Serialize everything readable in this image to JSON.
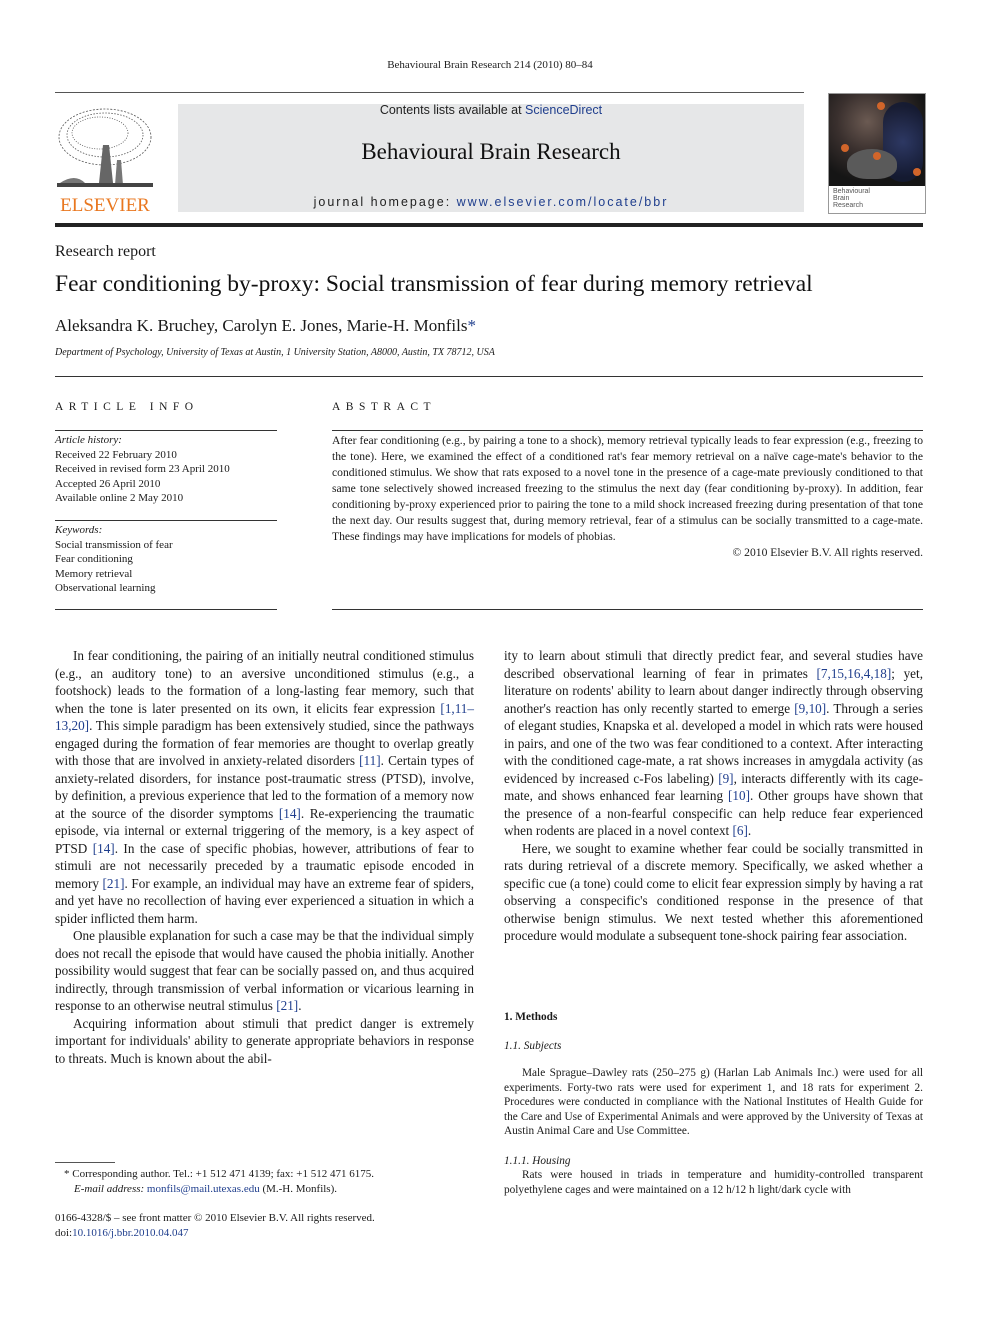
{
  "running_head": "Behavioural Brain Research 214 (2010) 80–84",
  "masthead": {
    "publisher_logo_text": "ELSEVIER",
    "contents_prefix": "Contents lists available at ",
    "contents_link": "ScienceDirect",
    "journal_title": "Behavioural Brain Research",
    "homepage_prefix": "journal homepage: ",
    "homepage_link": "www.elsevier.com/locate/bbr",
    "cover_text_lines": [
      "Behavioural",
      "Brain",
      "Research"
    ]
  },
  "article": {
    "type": "Research report",
    "title": "Fear conditioning by-proxy: Social transmission of fear during memory retrieval",
    "authors": "Aleksandra K. Bruchey, Carolyn E. Jones, Marie-H. Monfils",
    "corresponding_marker": "*",
    "affiliation": "Department of Psychology, University of Texas at Austin, 1 University Station, A8000, Austin, TX 78712, USA"
  },
  "article_info": {
    "heading": "ARTICLE INFO",
    "history_label": "Article history:",
    "history": [
      "Received 22 February 2010",
      "Received in revised form 23 April 2010",
      "Accepted 26 April 2010",
      "Available online 2 May 2010"
    ],
    "keywords_label": "Keywords:",
    "keywords": [
      "Social transmission of fear",
      "Fear conditioning",
      "Memory retrieval",
      "Observational learning"
    ]
  },
  "abstract": {
    "heading": "ABSTRACT",
    "text": "After fear conditioning (e.g., by pairing a tone to a shock), memory retrieval typically leads to fear expression (e.g., freezing to the tone). Here, we examined the effect of a conditioned rat's fear memory retrieval on a naïve cage-mate's behavior to the conditioned stimulus. We show that rats exposed to a novel tone in the presence of a cage-mate previously conditioned to that same tone selectively showed increased freezing to the stimulus the next day (fear conditioning by-proxy). In addition, fear conditioning by-proxy experienced prior to pairing the tone to a mild shock increased freezing during presentation of that tone the next day. Our results suggest that, during memory retrieval, fear of a stimulus can be socially transmitted to a cage-mate. These findings may have implications for models of phobias.",
    "copyright": "© 2010 Elsevier B.V. All rights reserved."
  },
  "body_left": {
    "p1": [
      {
        "t": "In fear conditioning, the pairing of an initially neutral conditioned stimulus (e.g., an auditory tone) to an aversive unconditioned stimulus (e.g., a footshock) leads to the formation of a long-lasting fear memory, such that when the tone is later presented on its own, it elicits fear expression "
      },
      {
        "r": "[1,11–13,20]"
      },
      {
        "t": ". This simple paradigm has been extensively studied, since the pathways engaged during the formation of fear memories are thought to overlap greatly with those that are involved in anxiety-related disorders "
      },
      {
        "r": "[11]"
      },
      {
        "t": ". Certain types of anxiety-related disorders, for instance post-traumatic stress (PTSD), involve, by definition, a previous experience that led to the formation of a memory now at the source of the disorder symptoms "
      },
      {
        "r": "[14]"
      },
      {
        "t": ". Re-experiencing the traumatic episode, via internal or external triggering of the memory, is a key aspect of PTSD "
      },
      {
        "r": "[14]"
      },
      {
        "t": ". In the case of specific phobias, however, attributions of fear to stimuli are not necessarily preceded by a traumatic episode encoded in memory "
      },
      {
        "r": "[21]"
      },
      {
        "t": ". For example, an individual may have an extreme fear of spiders, and yet have no recollection of having ever experienced a situation in which a spider inflicted them harm."
      }
    ],
    "p2": [
      {
        "t": "One plausible explanation for such a case may be that the individual simply does not recall the episode that would have caused the phobia initially. Another possibility would suggest that fear can be socially passed on, and thus acquired indirectly, through transmission of verbal information or vicarious learning in response to an otherwise neutral stimulus "
      },
      {
        "r": "[21]"
      },
      {
        "t": "."
      }
    ],
    "p3": [
      {
        "t": "Acquiring information about stimuli that predict danger is extremely important for individuals' ability to generate appropriate behaviors in response to threats. Much is known about the abil-"
      }
    ]
  },
  "body_right": {
    "p1": [
      {
        "t": "ity to learn about stimuli that directly predict fear, and several studies have described observational learning of fear in primates "
      },
      {
        "r": "[7,15,16,4,18]"
      },
      {
        "t": "; yet, literature on rodents' ability to learn about danger indirectly through observing another's reaction has only recently started to emerge "
      },
      {
        "r": "[9,10]"
      },
      {
        "t": ". Through a series of elegant studies, Knapska et al. developed a model in which rats were housed in pairs, and one of the two was fear conditioned to a context. After interacting with the conditioned cage-mate, a rat shows increases in amygdala activity (as evidenced by increased c-Fos labeling) "
      },
      {
        "r": "[9]"
      },
      {
        "t": ", interacts differently with its cage-mate, and shows enhanced fear learning "
      },
      {
        "r": "[10]"
      },
      {
        "t": ". Other groups have shown that the presence of a non-fearful conspecific can help reduce fear experienced when rodents are placed in a novel context "
      },
      {
        "r": "[6]"
      },
      {
        "t": "."
      }
    ],
    "p2": [
      {
        "t": "Here, we sought to examine whether fear could be socially transmitted in rats during retrieval of a discrete memory. Specifically, we asked whether a specific cue (a tone) could come to elicit fear expression simply by having a rat observing a conspecific's conditioned response in the presence of that otherwise benign stimulus. We next tested whether this aforementioned procedure would modulate a subsequent tone-shock pairing fear association."
      }
    ],
    "methods_heading": "1.  Methods",
    "subjects_heading": "1.1.  Subjects",
    "subjects_text": "Male Sprague–Dawley rats (250–275 g) (Harlan Lab Animals Inc.) were used for all experiments. Forty-two rats were used for experiment 1, and 18 rats for experiment 2. Procedures were conducted in compliance with the National Institutes of Health Guide for the Care and Use of Experimental Animals and were approved by the University of Texas at Austin Animal Care and Use Committee.",
    "housing_heading": "1.1.1.  Housing",
    "housing_text": "Rats were housed in triads in temperature and humidity-controlled transparent polyethylene cages and were maintained on a 12 h/12 h light/dark cycle with"
  },
  "footnotes": {
    "corresponding": "* Corresponding author. Tel.: +1 512 471 4139; fax: +1 512 471 6175.",
    "email_label": "E-mail address: ",
    "email": "monfils@mail.utexas.edu",
    "email_suffix": " (M.-H. Monfils).",
    "issn_line": "0166-4328/$ – see front matter © 2010 Elsevier B.V. All rights reserved.",
    "doi_prefix": "doi:",
    "doi": "10.1016/j.bbr.2010.04.047"
  },
  "colors": {
    "link": "#1f3e8d",
    "elsevier_orange": "#e9771f",
    "masthead_gray": "#e6e7e8"
  }
}
